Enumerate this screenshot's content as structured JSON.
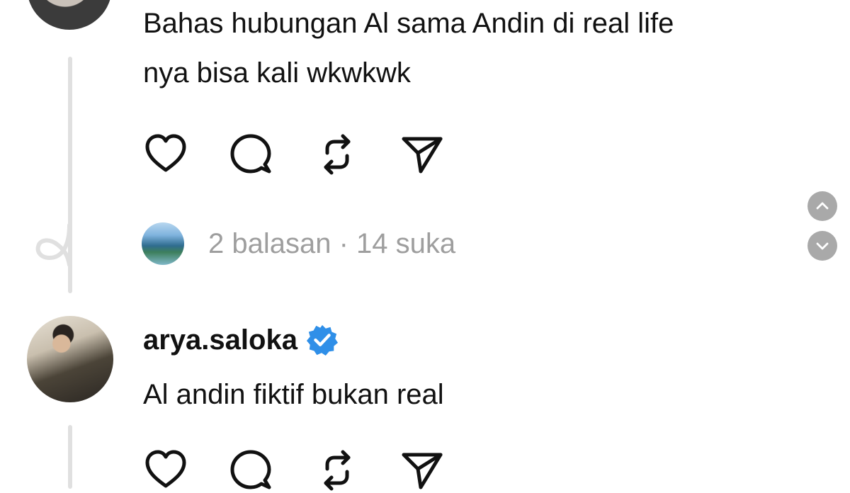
{
  "comment_top": {
    "text_line1": "Bahas hubungan Al sama Andin di real life",
    "text_line2": "nya bisa kali wkwkwk",
    "replies_meta": "2 balasan · 14 suka"
  },
  "comment_arya": {
    "username": "arya.saloka",
    "verified": true,
    "text": "Al andin fiktif bukan real"
  },
  "actions": {
    "icons": [
      "heart-icon",
      "comment-icon",
      "repost-icon",
      "share-icon"
    ]
  },
  "colors": {
    "text": "#111111",
    "muted": "#9e9e9e",
    "thread_line": "#e0e0e0",
    "verified_badge": "#2f8fe8",
    "scroll_button": "#a9a9a9"
  }
}
